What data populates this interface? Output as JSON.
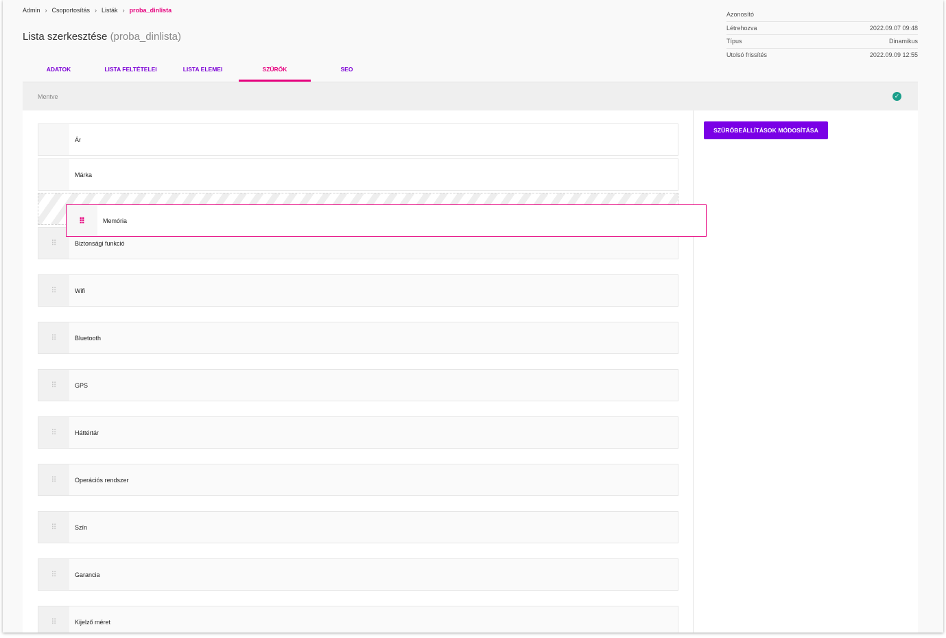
{
  "breadcrumb": {
    "items": [
      "Admin",
      "Csoportosítás",
      "Listák"
    ],
    "current": "proba_dinlista",
    "separator": "›"
  },
  "page": {
    "title": "Lista szerkesztése",
    "subtitle": "(proba_dinlista)"
  },
  "meta": [
    {
      "label": "Azonosító",
      "value": ""
    },
    {
      "label": "Létrehozva",
      "value": "2022.09.07 09:48"
    },
    {
      "label": "Típus",
      "value": "Dinamikus"
    },
    {
      "label": "Utolsó frissítés",
      "value": "2022.09.09 12:55"
    }
  ],
  "tabs": [
    {
      "label": "ADATOK",
      "active": false
    },
    {
      "label": "LISTA FELTÉTELEI",
      "active": false
    },
    {
      "label": "LISTA ELEMEI",
      "active": false
    },
    {
      "label": "SZŰRŐK",
      "active": true
    },
    {
      "label": "SEO",
      "active": false
    }
  ],
  "status": {
    "text": "Mentve",
    "icon": "check-circle-icon",
    "color": "#1a9e8a"
  },
  "actions": {
    "edit_filters_label": "SZŰRŐBEÁLLÍTÁSOK MÓDOSÍTÁSA"
  },
  "filters": {
    "static": [
      "Ár",
      "Márka"
    ],
    "dragging": "Memória",
    "sortable": [
      "Biztonsági funkció",
      "Wifi",
      "Bluetooth",
      "GPS",
      "Háttértár",
      "Operációs rendszer",
      "Szín",
      "Garancia",
      "Kijelző méret"
    ]
  },
  "colors": {
    "accent": "#e6007e",
    "primary": "#7a00e6",
    "success": "#1a9e8a"
  },
  "icons": {
    "drag_handle": "drag-handle-icon",
    "check": "check-circle-icon"
  }
}
